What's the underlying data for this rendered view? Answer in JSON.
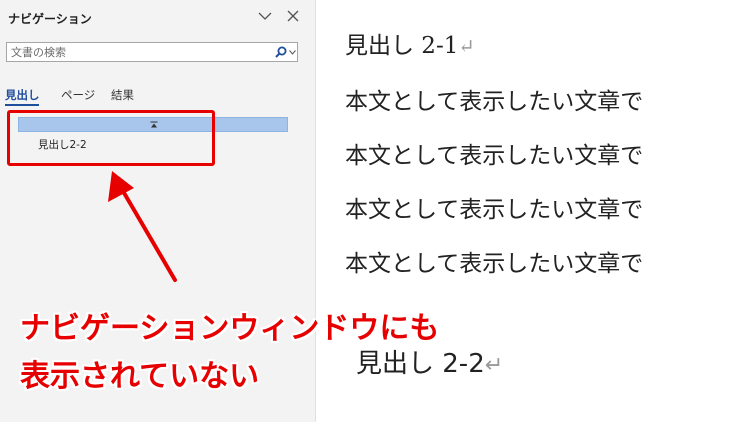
{
  "nav": {
    "title": "ナビゲーション",
    "search_placeholder": "文書の検索",
    "tabs": [
      {
        "label": "見出し",
        "active": true
      },
      {
        "label": "ページ",
        "active": false
      },
      {
        "label": "結果",
        "active": false
      }
    ],
    "heading_items": [
      "見出し2-2"
    ]
  },
  "document": {
    "heading_1": "見出し 2-1",
    "body_lines": [
      "本文として表示したい文章で",
      "本文として表示したい文章で",
      "本文として表示したい文章で",
      "本文として表示したい文章で"
    ],
    "heading_2": "見出し 2-2",
    "paragraph_mark": "↵"
  },
  "annotation": {
    "line1": "ナビゲーションウィンドウにも",
    "line2": "表示されていない",
    "color": "#e60000"
  },
  "colors": {
    "accent": "#1f4e9c",
    "selected_heading": "#a8c6ec",
    "pane_bg": "#f3f3f3"
  },
  "icons": [
    "chevron-down-icon",
    "close-icon",
    "search-icon",
    "dropdown-arrow-icon",
    "collapse-icon",
    "pointer-arrow-icon"
  ]
}
